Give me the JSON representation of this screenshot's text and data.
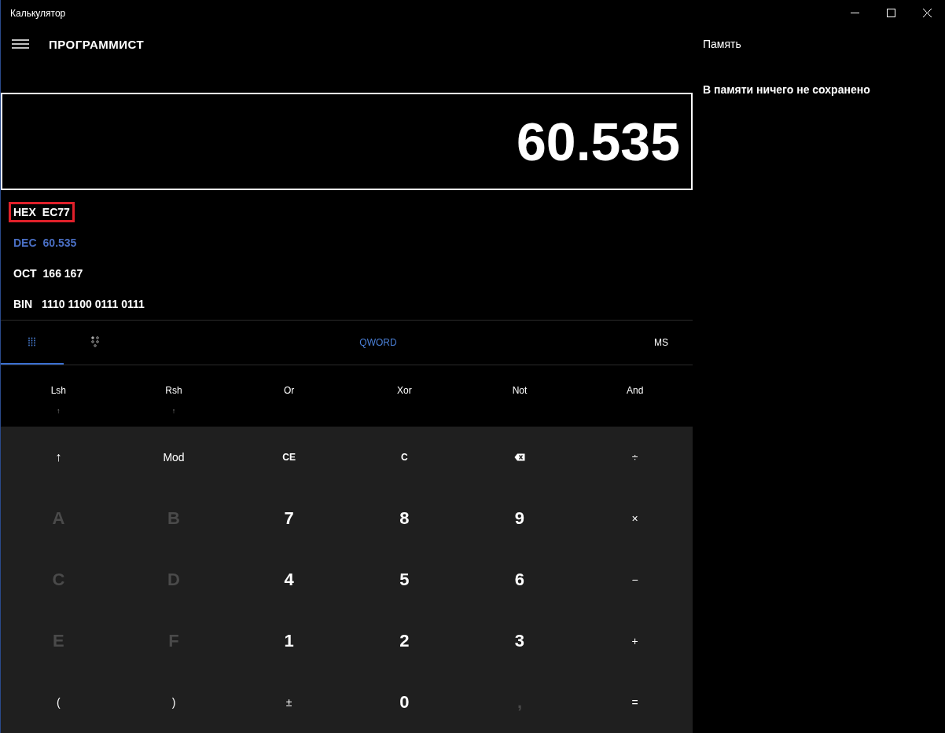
{
  "window": {
    "title": "Калькулятор"
  },
  "header": {
    "mode": "ПРОГРАММИСТ"
  },
  "display": {
    "value": "60.535"
  },
  "radix": [
    {
      "label": "HEX",
      "value": "EC77",
      "selected": false,
      "highlighted": true
    },
    {
      "label": "DEC",
      "value": "60.535",
      "selected": true,
      "highlighted": false
    },
    {
      "label": "OCT",
      "value": "166 167",
      "selected": false,
      "highlighted": false
    },
    {
      "label": "BIN",
      "value": "1110 1100 0111 0111",
      "selected": false,
      "highlighted": false
    }
  ],
  "toolbar": {
    "tabs": [
      {
        "kind": "keypad",
        "selected": true
      },
      {
        "kind": "bits",
        "selected": false
      }
    ],
    "word_size": "QWORD",
    "memory_store": "MS"
  },
  "bit_ops": [
    {
      "label": "Lsh",
      "sub": "↑"
    },
    {
      "label": "Rsh",
      "sub": "↑"
    },
    {
      "label": "Or"
    },
    {
      "label": "Xor"
    },
    {
      "label": "Not"
    },
    {
      "label": "And"
    }
  ],
  "keys": [
    [
      {
        "kind": "op",
        "label": "↑",
        "disabled": false
      },
      {
        "kind": "op",
        "label": "Mod",
        "disabled": false
      },
      {
        "kind": "bold",
        "label": "CE",
        "disabled": false
      },
      {
        "kind": "bold",
        "label": "C",
        "disabled": false
      },
      {
        "kind": "backspace",
        "disabled": false
      },
      {
        "kind": "op",
        "label": "÷",
        "disabled": false
      }
    ],
    [
      {
        "kind": "digit",
        "label": "A",
        "disabled": true
      },
      {
        "kind": "digit",
        "label": "B",
        "disabled": true
      },
      {
        "kind": "digit",
        "label": "7",
        "disabled": false
      },
      {
        "kind": "digit",
        "label": "8",
        "disabled": false
      },
      {
        "kind": "digit",
        "label": "9",
        "disabled": false
      },
      {
        "kind": "op",
        "label": "×",
        "disabled": false
      }
    ],
    [
      {
        "kind": "digit",
        "label": "C",
        "disabled": true
      },
      {
        "kind": "digit",
        "label": "D",
        "disabled": true
      },
      {
        "kind": "digit",
        "label": "4",
        "disabled": false
      },
      {
        "kind": "digit",
        "label": "5",
        "disabled": false
      },
      {
        "kind": "digit",
        "label": "6",
        "disabled": false
      },
      {
        "kind": "op",
        "label": "−",
        "disabled": false
      }
    ],
    [
      {
        "kind": "digit",
        "label": "E",
        "disabled": true
      },
      {
        "kind": "digit",
        "label": "F",
        "disabled": true
      },
      {
        "kind": "digit",
        "label": "1",
        "disabled": false
      },
      {
        "kind": "digit",
        "label": "2",
        "disabled": false
      },
      {
        "kind": "digit",
        "label": "3",
        "disabled": false
      },
      {
        "kind": "op",
        "label": "+",
        "disabled": false
      }
    ],
    [
      {
        "kind": "op",
        "label": "(",
        "disabled": false
      },
      {
        "kind": "op",
        "label": ")",
        "disabled": false
      },
      {
        "kind": "op",
        "label": "±",
        "disabled": false
      },
      {
        "kind": "digit",
        "label": "0",
        "disabled": false
      },
      {
        "kind": "digit",
        "label": ",",
        "disabled": true
      },
      {
        "kind": "op",
        "label": "=",
        "disabled": false
      }
    ]
  ],
  "memory": {
    "title": "Память",
    "empty_text": "В памяти ничего не сохранено"
  }
}
